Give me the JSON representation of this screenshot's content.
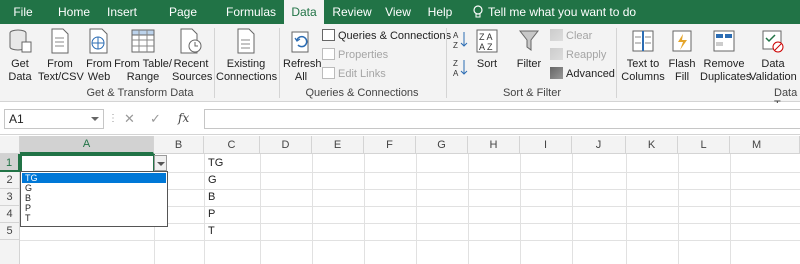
{
  "tabs": [
    "File",
    "Home",
    "Insert",
    "Page Layout",
    "Formulas",
    "Data",
    "Review",
    "View",
    "Help"
  ],
  "active_tab": "Data",
  "tell_me": "Tell me what you want to do",
  "ribbon": {
    "get_data": [
      "Get",
      "Data"
    ],
    "from_text": [
      "From",
      "Text/CSV"
    ],
    "from_web": [
      "From",
      "Web"
    ],
    "from_table": [
      "From Table/",
      "Range"
    ],
    "recent_sources": [
      "Recent",
      "Sources"
    ],
    "existing_connections": [
      "Existing",
      "Connections"
    ],
    "refresh_all": [
      "Refresh",
      "All"
    ],
    "queries_connections": "Queries & Connections",
    "properties": "Properties",
    "edit_links": "Edit Links",
    "sort_label": "Sort",
    "filter_label": "Filter",
    "clear": "Clear",
    "reapply": "Reapply",
    "advanced": "Advanced",
    "text_to_columns": [
      "Text to",
      "Columns"
    ],
    "flash_fill": [
      "Flash",
      "Fill"
    ],
    "remove_duplicates": [
      "Remove",
      "Duplicates"
    ],
    "data_validation": [
      "Data",
      "Validation"
    ],
    "groups": {
      "get_transform": "Get & Transform Data",
      "queries": "Queries & Connections",
      "sort_filter": "Sort & Filter",
      "data_tools": "Data T"
    }
  },
  "formula_bar": {
    "name_box": "A1",
    "fx": "fx",
    "formula": ""
  },
  "sheet": {
    "columns": [
      "A",
      "B",
      "C",
      "D",
      "E",
      "F",
      "G",
      "H",
      "I",
      "J",
      "K",
      "L",
      "M"
    ],
    "rows": [
      "1",
      "2",
      "3",
      "4",
      "5"
    ],
    "c_values": [
      "TG",
      "G",
      "B",
      "P",
      "T"
    ]
  },
  "dropdown": {
    "options": [
      "TG",
      "G",
      "B",
      "P",
      "T"
    ],
    "highlighted": "TG"
  },
  "colors": {
    "accent": "#217346",
    "highlight": "#0078d7"
  }
}
